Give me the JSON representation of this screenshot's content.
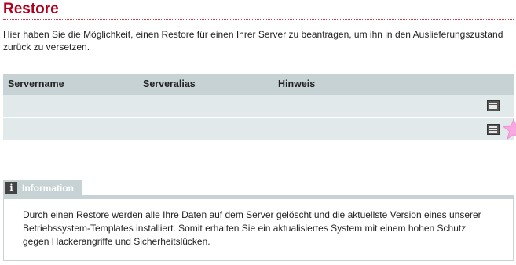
{
  "page": {
    "title": "Restore",
    "intro": "Hier haben Sie die Möglichkeit, einen Restore für einen Ihrer Server zu beantragen, um ihn in den Auslieferungszustand zurück zu versetzen."
  },
  "table": {
    "columns": [
      "Servername",
      "Serveralias",
      "Hinweis"
    ],
    "rows": [
      {
        "servername": "",
        "serveralias": "",
        "hinweis": "",
        "action_icon": "menu-icon"
      },
      {
        "servername": "",
        "serveralias": "",
        "hinweis": "",
        "action_icon": "menu-icon"
      }
    ]
  },
  "info": {
    "icon": "info-icon",
    "icon_glyph": "i",
    "label": "Information",
    "text": "Durch einen Restore werden alle Ihre Daten auf dem Server gelöscht und die aktuellste Version eines unserer Betriebssystem-Templates installiert. Somit erhalten Sie ein aktualisiertes System mit einem hohen Schutz gegen Hackerangriffe und Sicherheitslücken."
  },
  "colors": {
    "title": "#b0001e",
    "header_bg": "#c6d2d4",
    "row_bg": "#e2e9ea",
    "star": "#f7a8e0"
  }
}
